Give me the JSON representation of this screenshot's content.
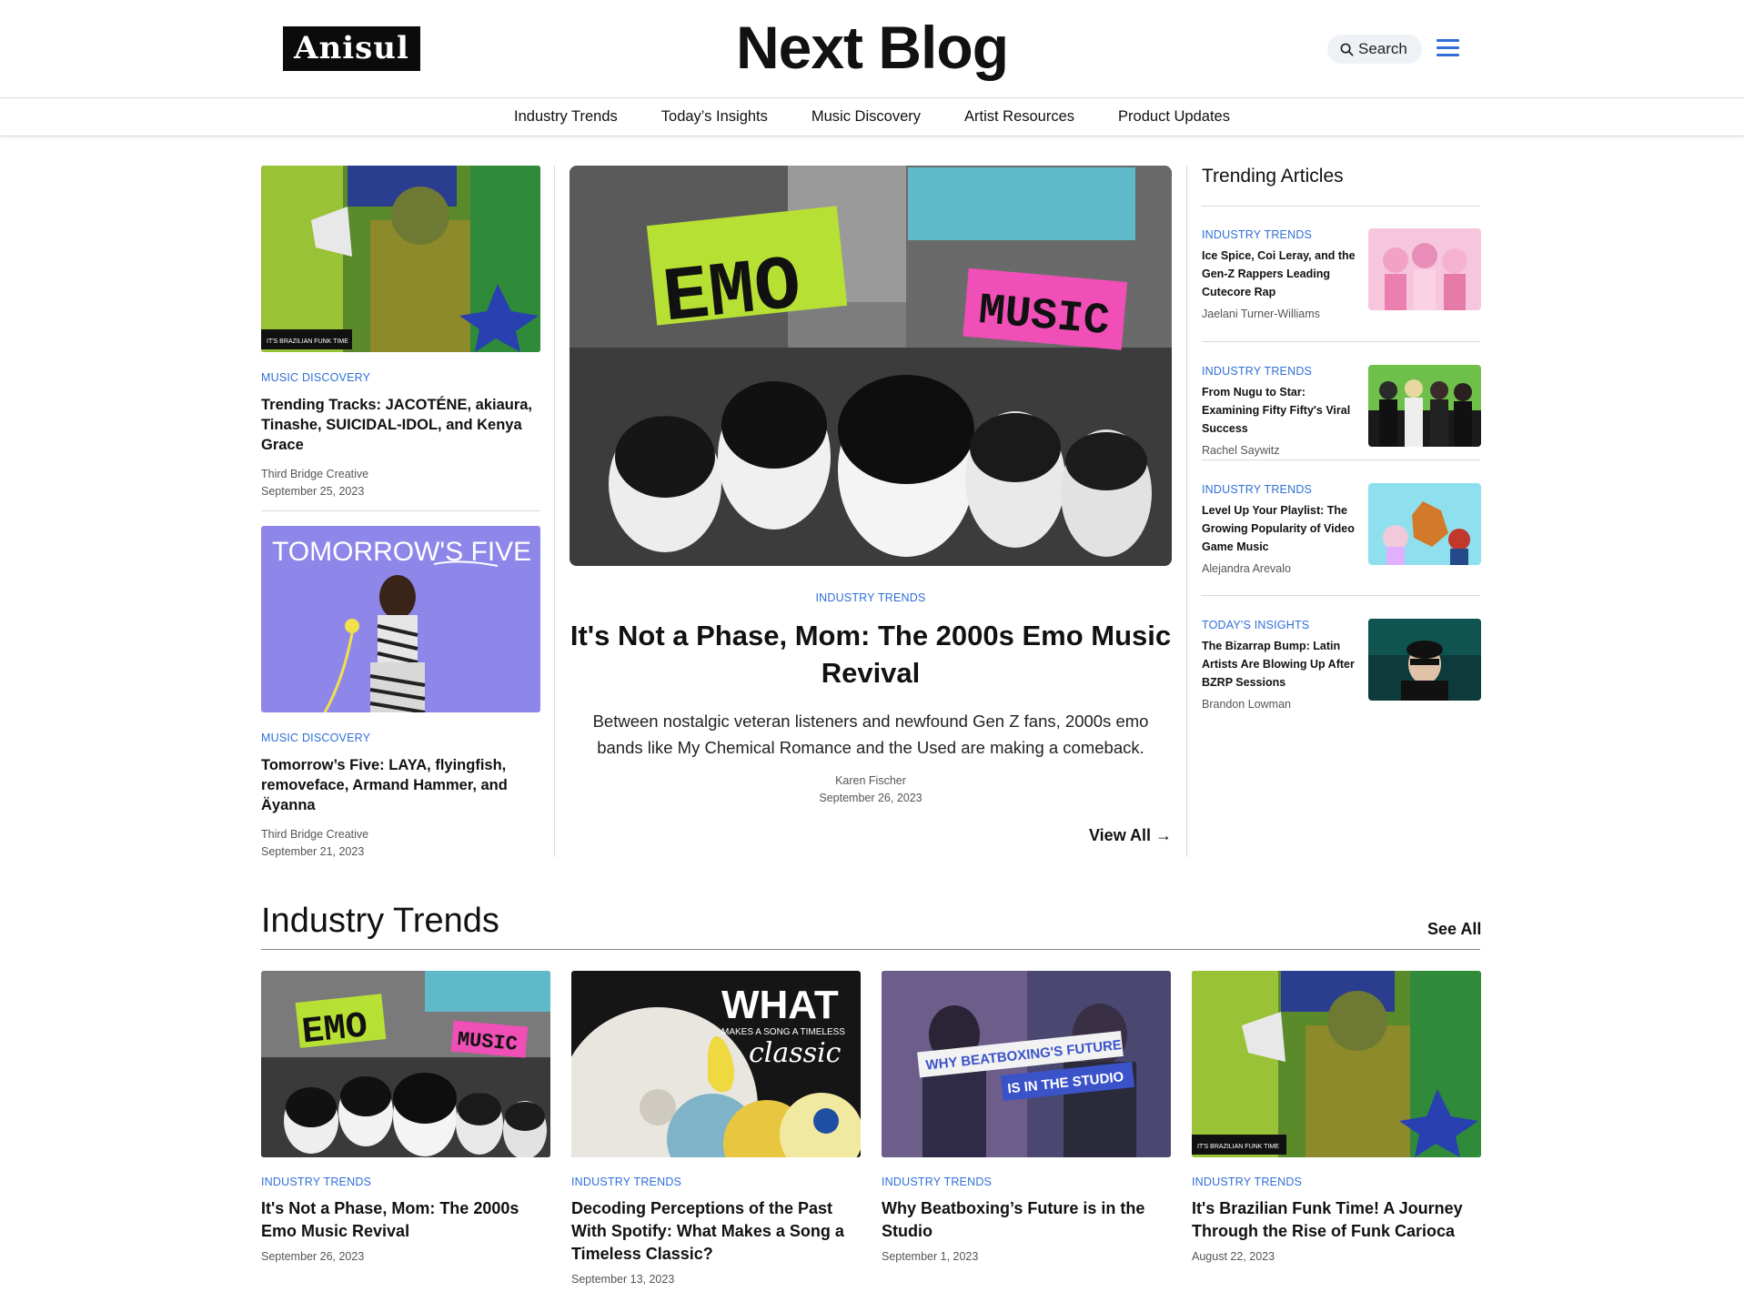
{
  "header": {
    "logo_text": "Anisul",
    "site_title": "Next Blog",
    "search_label": "Search"
  },
  "nav": {
    "items": [
      "Industry Trends",
      "Today’s Insights",
      "Music Discovery",
      "Artist Resources",
      "Product Updates"
    ]
  },
  "left_column": [
    {
      "category": "Music Discovery",
      "title": "Trending Tracks: JACOTÉNE, akiaura, Tinashe, SUICIDAL-IDOL, and Kenya Grace",
      "author": "Third Bridge Creative",
      "date": "September 25, 2023",
      "image_caption": "IT'S BRAZILIAN FUNK TIME"
    },
    {
      "category": "Music Discovery",
      "title": "Tomorrow’s Five: LAYA, flyingfish, removeface, Armand Hammer, and Äyanna",
      "author": "Third Bridge Creative",
      "date": "September 21, 2023",
      "image_caption": "TOMORROW'S FIVE"
    }
  ],
  "featured": {
    "category": "Industry Trends",
    "title": "It's Not a Phase, Mom: The 2000s Emo Music Revival",
    "excerpt": "Between nostalgic veteran listeners and newfound Gen Z fans, 2000s emo bands like My Chemical Romance and the Used are making a comeback.",
    "author": "Karen Fischer",
    "date": "September 26, 2023",
    "image_word_1": "EMO",
    "image_word_2": "MUSIC",
    "view_all_label": "View All →"
  },
  "trending": {
    "heading": "Trending Articles",
    "items": [
      {
        "category": "Industry Trends",
        "title": "Ice Spice, Coi Leray, and the Gen-Z Rappers Leading Cutecore Rap",
        "author": "Jaelani Turner-Williams"
      },
      {
        "category": "Industry Trends",
        "title": "From Nugu to Star: Examining Fifty Fifty's Viral Success",
        "author": "Rachel Saywitz"
      },
      {
        "category": "Industry Trends",
        "title": "Level Up Your Playlist: The Growing Popularity of Video Game Music",
        "author": "Alejandra Arevalo"
      },
      {
        "category": "Today's Insights",
        "title": "The Bizarrap Bump: Latin Artists Are Blowing Up After BZRP Sessions",
        "author": "Brandon Lowman"
      }
    ]
  },
  "industry_section": {
    "heading": "Industry Trends",
    "see_all_label": "See All",
    "cards": [
      {
        "category": "Industry Trends",
        "title": "It's Not a Phase, Mom: The 2000s Emo Music Revival",
        "date": "September 26, 2023"
      },
      {
        "category": "Industry Trends",
        "title": "Decoding Perceptions of the Past With Spotify: What Makes a Song a Timeless Classic?",
        "date": "September 13, 2023"
      },
      {
        "category": "Industry Trends",
        "title": "Why Beatboxing’s Future is in the Studio",
        "date": "September 1, 2023"
      },
      {
        "category": "Industry Trends",
        "title": "It's Brazilian Funk Time! A Journey Through the Rise of Funk Carioca",
        "date": "August 22, 2023"
      }
    ],
    "image_text": {
      "what": "WHAT",
      "makes": "MAKES A SONG A TIMELESS",
      "classic": "classic",
      "beat_1": "WHY BEATBOXING'S FUTURE",
      "beat_2": "IS IN THE STUDIO"
    }
  },
  "colors": {
    "accent": "#2f6fd6",
    "divider": "#d9d9d9",
    "text": "#111111"
  }
}
